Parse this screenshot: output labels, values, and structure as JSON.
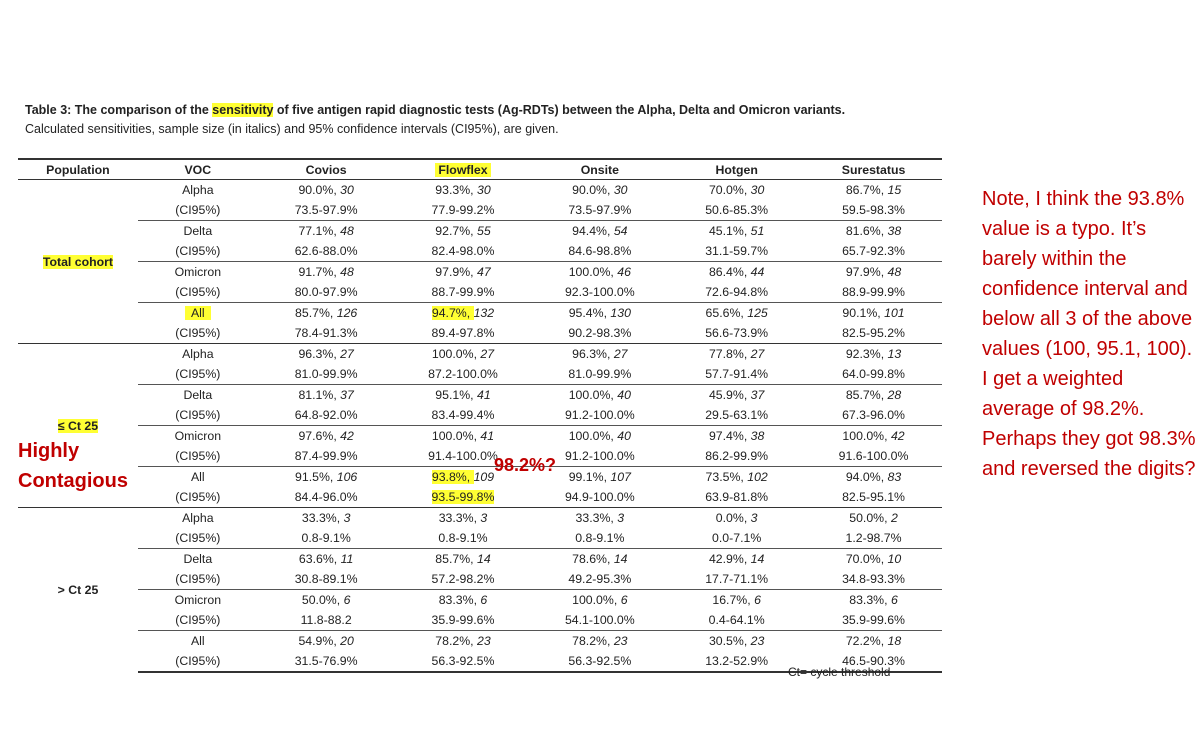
{
  "caption": {
    "prefix": "Table 3: The comparison of the ",
    "highlight": "sensitivity",
    "suffix": " of five antigen rapid diagnostic tests (Ag-RDTs) between the Alpha, Delta and Omicron variants.",
    "line2": "Calculated sensitivities, sample size (in italics) and 95% confidence intervals (CI95%), are given."
  },
  "table": {
    "headers": [
      "Population",
      "VOC",
      "Covios",
      "Flowflex",
      "Onsite",
      "Hotgen",
      "Surestatus"
    ],
    "highlighted_header": "Flowflex",
    "ci_label": "(CI95%)",
    "populations": [
      {
        "name": "Total cohort",
        "highlighted": true,
        "groups": [
          {
            "voc": "Alpha",
            "vals": [
              [
                "90.0%",
                "30"
              ],
              [
                "93.3%",
                "30"
              ],
              [
                "90.0%",
                "30"
              ],
              [
                "70.0%",
                "30"
              ],
              [
                "86.7%",
                "15"
              ]
            ],
            "ci": [
              "73.5-97.9%",
              "77.9-99.2%",
              "73.5-97.9%",
              "50.6-85.3%",
              "59.5-98.3%"
            ]
          },
          {
            "voc": "Delta",
            "vals": [
              [
                "77.1%",
                "48"
              ],
              [
                "92.7%",
                "55"
              ],
              [
                "94.4%",
                "54"
              ],
              [
                "45.1%",
                "51"
              ],
              [
                "81.6%",
                "38"
              ]
            ],
            "ci": [
              "62.6-88.0%",
              "82.4-98.0%",
              "84.6-98.8%",
              "31.1-59.7%",
              "65.7-92.3%"
            ]
          },
          {
            "voc": "Omicron",
            "vals": [
              [
                "91.7%",
                "48"
              ],
              [
                "97.9%",
                "47"
              ],
              [
                "100.0%",
                "46"
              ],
              [
                "86.4%",
                "44"
              ],
              [
                "97.9%",
                "48"
              ]
            ],
            "ci": [
              "80.0-97.9%",
              "88.7-99.9%",
              "92.3-100.0%",
              "72.6-94.8%",
              "88.9-99.9%"
            ]
          },
          {
            "voc": "All",
            "voc_highlighted": true,
            "vals": [
              [
                "85.7%",
                "126"
              ],
              [
                "94.7%",
                "132"
              ],
              [
                "95.4%",
                "130"
              ],
              [
                "65.6%",
                "125"
              ],
              [
                "90.1%",
                "101"
              ]
            ],
            "ci": [
              "78.4-91.3%",
              "89.4-97.8%",
              "90.2-98.3%",
              "56.6-73.9%",
              "82.5-95.2%"
            ],
            "highlight_val_col": 1
          }
        ]
      },
      {
        "name": "≤ Ct 25",
        "highlighted": true,
        "groups": [
          {
            "voc": "Alpha",
            "vals": [
              [
                "96.3%",
                "27"
              ],
              [
                "100.0%",
                "27"
              ],
              [
                "96.3%",
                "27"
              ],
              [
                "77.8%",
                "27"
              ],
              [
                "92.3%",
                "13"
              ]
            ],
            "ci": [
              "81.0-99.9%",
              "87.2-100.0%",
              "81.0-99.9%",
              "57.7-91.4%",
              "64.0-99.8%"
            ]
          },
          {
            "voc": "Delta",
            "vals": [
              [
                "81.1%",
                "37"
              ],
              [
                "95.1%",
                "41"
              ],
              [
                "100.0%",
                "40"
              ],
              [
                "45.9%",
                "37"
              ],
              [
                "85.7%",
                "28"
              ]
            ],
            "ci": [
              "64.8-92.0%",
              "83.4-99.4%",
              "91.2-100.0%",
              "29.5-63.1%",
              "67.3-96.0%"
            ]
          },
          {
            "voc": "Omicron",
            "vals": [
              [
                "97.6%",
                "42"
              ],
              [
                "100.0%",
                "41"
              ],
              [
                "100.0%",
                "40"
              ],
              [
                "97.4%",
                "38"
              ],
              [
                "100.0%",
                "42"
              ]
            ],
            "ci": [
              "87.4-99.9%",
              "91.4-100.0%",
              "91.2-100.0%",
              "86.2-99.9%",
              "91.6-100.0%"
            ]
          },
          {
            "voc": "All",
            "vals": [
              [
                "91.5%",
                "106"
              ],
              [
                "93.8%",
                "109"
              ],
              [
                "99.1%",
                "107"
              ],
              [
                "73.5%",
                "102"
              ],
              [
                "94.0%",
                "83"
              ]
            ],
            "ci": [
              "84.4-96.0%",
              "93.5-99.8%",
              "94.9-100.0%",
              "63.9-81.8%",
              "82.5-95.1%"
            ],
            "highlight_val_col": 1,
            "highlight_ci_col": 1
          }
        ]
      },
      {
        "name": "> Ct 25",
        "highlighted": false,
        "groups": [
          {
            "voc": "Alpha",
            "vals": [
              [
                "33.3%",
                "3"
              ],
              [
                "33.3%",
                "3"
              ],
              [
                "33.3%",
                "3"
              ],
              [
                "0.0%",
                "3"
              ],
              [
                "50.0%",
                "2"
              ]
            ],
            "ci": [
              "0.8-9.1%",
              "0.8-9.1%",
              "0.8-9.1%",
              "0.0-7.1%",
              "1.2-98.7%"
            ]
          },
          {
            "voc": "Delta",
            "vals": [
              [
                "63.6%",
                "11"
              ],
              [
                "85.7%",
                "14"
              ],
              [
                "78.6%",
                "14"
              ],
              [
                "42.9%",
                "14"
              ],
              [
                "70.0%",
                "10"
              ]
            ],
            "ci": [
              "30.8-89.1%",
              "57.2-98.2%",
              "49.2-95.3%",
              "17.7-71.1%",
              "34.8-93.3%"
            ]
          },
          {
            "voc": "Omicron",
            "vals": [
              [
                "50.0%",
                "6"
              ],
              [
                "83.3%",
                "6"
              ],
              [
                "100.0%",
                "6"
              ],
              [
                "16.7%",
                "6"
              ],
              [
                "83.3%",
                "6"
              ]
            ],
            "ci": [
              "11.8-88.2",
              "35.9-99.6%",
              "54.1-100.0%",
              "0.4-64.1%",
              "35.9-99.6%"
            ]
          },
          {
            "voc": "All",
            "vals": [
              [
                "54.9%",
                "20"
              ],
              [
                "78.2%",
                "23"
              ],
              [
                "78.2%",
                "23"
              ],
              [
                "30.5%",
                "23"
              ],
              [
                "72.2%",
                "18"
              ]
            ],
            "ci": [
              "31.5-76.9%",
              "56.3-92.5%",
              "56.3-92.5%",
              "13.2-52.9%",
              "46.5-90.3%"
            ]
          }
        ]
      }
    ],
    "footnote": "Ct= cycle threshold"
  },
  "annotations": {
    "highly_contagious": [
      "Highly",
      "Contagious"
    ],
    "corrected_value": "98.2%?",
    "note": "Note, I think the 93.8% value is a typo. It’s barely within the confidence interval and below all 3 of the above values (100, 95.1, 100). I get a weighted average of 98.2%. Perhaps they got 98.3% and reversed the digits?"
  }
}
